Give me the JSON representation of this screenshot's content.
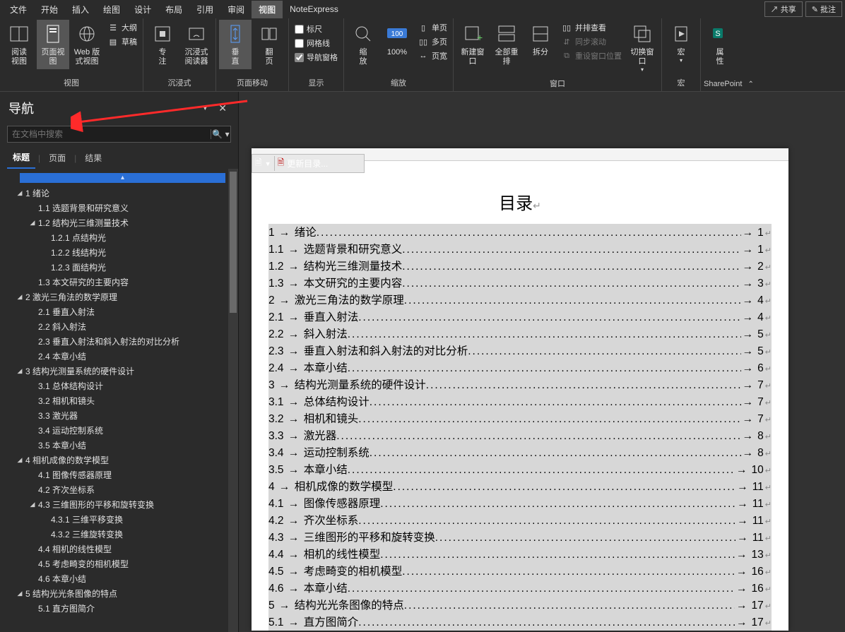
{
  "menu": {
    "file": "文件",
    "home": "开始",
    "insert": "插入",
    "draw": "绘图",
    "design": "设计",
    "layout": "布局",
    "references": "引用",
    "review": "审阅",
    "view": "视图",
    "noteexpress": "NoteExpress",
    "share": "共享",
    "comments": "批注"
  },
  "ribbon": {
    "views": {
      "label": "视图",
      "read": "阅读\n视图",
      "page": "页面视图",
      "web": "Web 版式视图",
      "outline": "大纲",
      "draft": "草稿"
    },
    "immersive": {
      "label": "沉浸式",
      "focus": "专\n注",
      "reader": "沉浸式\n阅读器"
    },
    "pagemove": {
      "label": "页面移动",
      "vertical": "垂\n直",
      "flip": "翻\n页"
    },
    "show": {
      "label": "显示",
      "ruler": "标尺",
      "grid": "网格线",
      "navpane": "导航窗格"
    },
    "zoom": {
      "label": "缩放",
      "zoom": "缩\n放",
      "p100": "100%",
      "one": "单页",
      "multi": "多页",
      "width": "页宽"
    },
    "window": {
      "label": "窗口",
      "newwin": "新建窗口",
      "arrange": "全部重排",
      "split": "拆分",
      "side": "并排查看",
      "sync": "同步滚动",
      "reset": "重设窗口位置",
      "switch": "切换窗口"
    },
    "macro": {
      "label": "宏",
      "macro": "宏"
    },
    "sp": {
      "label": "SharePoint",
      "props": "属\n性"
    }
  },
  "nav": {
    "title": "导航",
    "search_ph": "在文档中搜索",
    "tabs": {
      "headings": "标题",
      "pages": "页面",
      "results": "结果"
    }
  },
  "tree": [
    {
      "l": 0,
      "exp": true,
      "t": "1 绪论"
    },
    {
      "l": 1,
      "t": "1.1 选题背景和研究意义"
    },
    {
      "l": 1,
      "exp": true,
      "t": "1.2 结构光三维测量技术"
    },
    {
      "l": 2,
      "t": "1.2.1 点结构光"
    },
    {
      "l": 2,
      "t": "1.2.2 线结构光"
    },
    {
      "l": 2,
      "t": "1.2.3 面结构光"
    },
    {
      "l": 1,
      "t": "1.3 本文研究的主要内容"
    },
    {
      "l": 0,
      "exp": true,
      "t": "2 激光三角法的数学原理"
    },
    {
      "l": 1,
      "t": "2.1 垂直入射法"
    },
    {
      "l": 1,
      "t": "2.2 斜入射法"
    },
    {
      "l": 1,
      "t": "2.3 垂直入射法和斜入射法的对比分析"
    },
    {
      "l": 1,
      "t": "2.4 本章小结"
    },
    {
      "l": 0,
      "exp": true,
      "t": "3 结构光测量系统的硬件设计"
    },
    {
      "l": 1,
      "t": "3.1 总体结构设计"
    },
    {
      "l": 1,
      "t": "3.2 相机和镜头"
    },
    {
      "l": 1,
      "t": "3.3 激光器"
    },
    {
      "l": 1,
      "t": "3.4 运动控制系统"
    },
    {
      "l": 1,
      "t": "3.5 本章小结"
    },
    {
      "l": 0,
      "exp": true,
      "t": "4 相机成像的数学模型"
    },
    {
      "l": 1,
      "t": "4.1 图像传感器原理"
    },
    {
      "l": 1,
      "t": "4.2 齐次坐标系"
    },
    {
      "l": 1,
      "exp": true,
      "t": "4.3 三维图形的平移和旋转变换"
    },
    {
      "l": 2,
      "t": "4.3.1 三维平移变换"
    },
    {
      "l": 2,
      "t": "4.3.2 三维旋转变换"
    },
    {
      "l": 1,
      "t": "4.4 相机的线性模型"
    },
    {
      "l": 1,
      "t": "4.5 考虑畸变的相机模型"
    },
    {
      "l": 1,
      "t": "4.6 本章小结"
    },
    {
      "l": 0,
      "exp": true,
      "t": "5 结构光光条图像的特点"
    },
    {
      "l": 1,
      "t": "5.1 直方图简介"
    }
  ],
  "doc": {
    "title": "目录",
    "update": "更新目录...",
    "toc": [
      {
        "n": "1",
        "t": "绪论",
        "p": "1",
        "i": 0
      },
      {
        "n": "1.1",
        "t": "选题背景和研究意义",
        "p": "1",
        "i": 1
      },
      {
        "n": "1.2",
        "t": "结构光三维测量技术",
        "p": "2",
        "i": 1
      },
      {
        "n": "1.3",
        "t": "本文研究的主要内容",
        "p": "3",
        "i": 1
      },
      {
        "n": "2",
        "t": "激光三角法的数学原理",
        "p": "4",
        "i": 0
      },
      {
        "n": "2.1",
        "t": "垂直入射法",
        "p": "4",
        "i": 1
      },
      {
        "n": "2.2",
        "t": "斜入射法",
        "p": "5",
        "i": 1
      },
      {
        "n": "2.3",
        "t": "垂直入射法和斜入射法的对比分析",
        "p": "5",
        "i": 1
      },
      {
        "n": "2.4",
        "t": "本章小结",
        "p": "6",
        "i": 1
      },
      {
        "n": "3",
        "t": "结构光测量系统的硬件设计",
        "p": "7",
        "i": 0
      },
      {
        "n": "3.1",
        "t": "总体结构设计",
        "p": "7",
        "i": 1
      },
      {
        "n": "3.2",
        "t": "相机和镜头",
        "p": "7",
        "i": 1
      },
      {
        "n": "3.3",
        "t": "激光器",
        "p": "8",
        "i": 1
      },
      {
        "n": "3.4",
        "t": "运动控制系统",
        "p": "8",
        "i": 1
      },
      {
        "n": "3.5",
        "t": "本章小结",
        "p": "10",
        "i": 1
      },
      {
        "n": "4",
        "t": "相机成像的数学模型",
        "p": "11",
        "i": 0
      },
      {
        "n": "4.1",
        "t": "图像传感器原理",
        "p": "11",
        "i": 1
      },
      {
        "n": "4.2",
        "t": "齐次坐标系",
        "p": "11",
        "i": 1
      },
      {
        "n": "4.3",
        "t": "三维图形的平移和旋转变换",
        "p": "11",
        "i": 1
      },
      {
        "n": "4.4",
        "t": "相机的线性模型",
        "p": "13",
        "i": 1
      },
      {
        "n": "4.5",
        "t": "考虑畸变的相机模型",
        "p": "16",
        "i": 1
      },
      {
        "n": "4.6",
        "t": "本章小结",
        "p": "16",
        "i": 1
      },
      {
        "n": "5",
        "t": "结构光光条图像的特点",
        "p": "17",
        "i": 0
      },
      {
        "n": "5.1",
        "t": "直方图简介",
        "p": "17",
        "i": 1
      }
    ]
  }
}
